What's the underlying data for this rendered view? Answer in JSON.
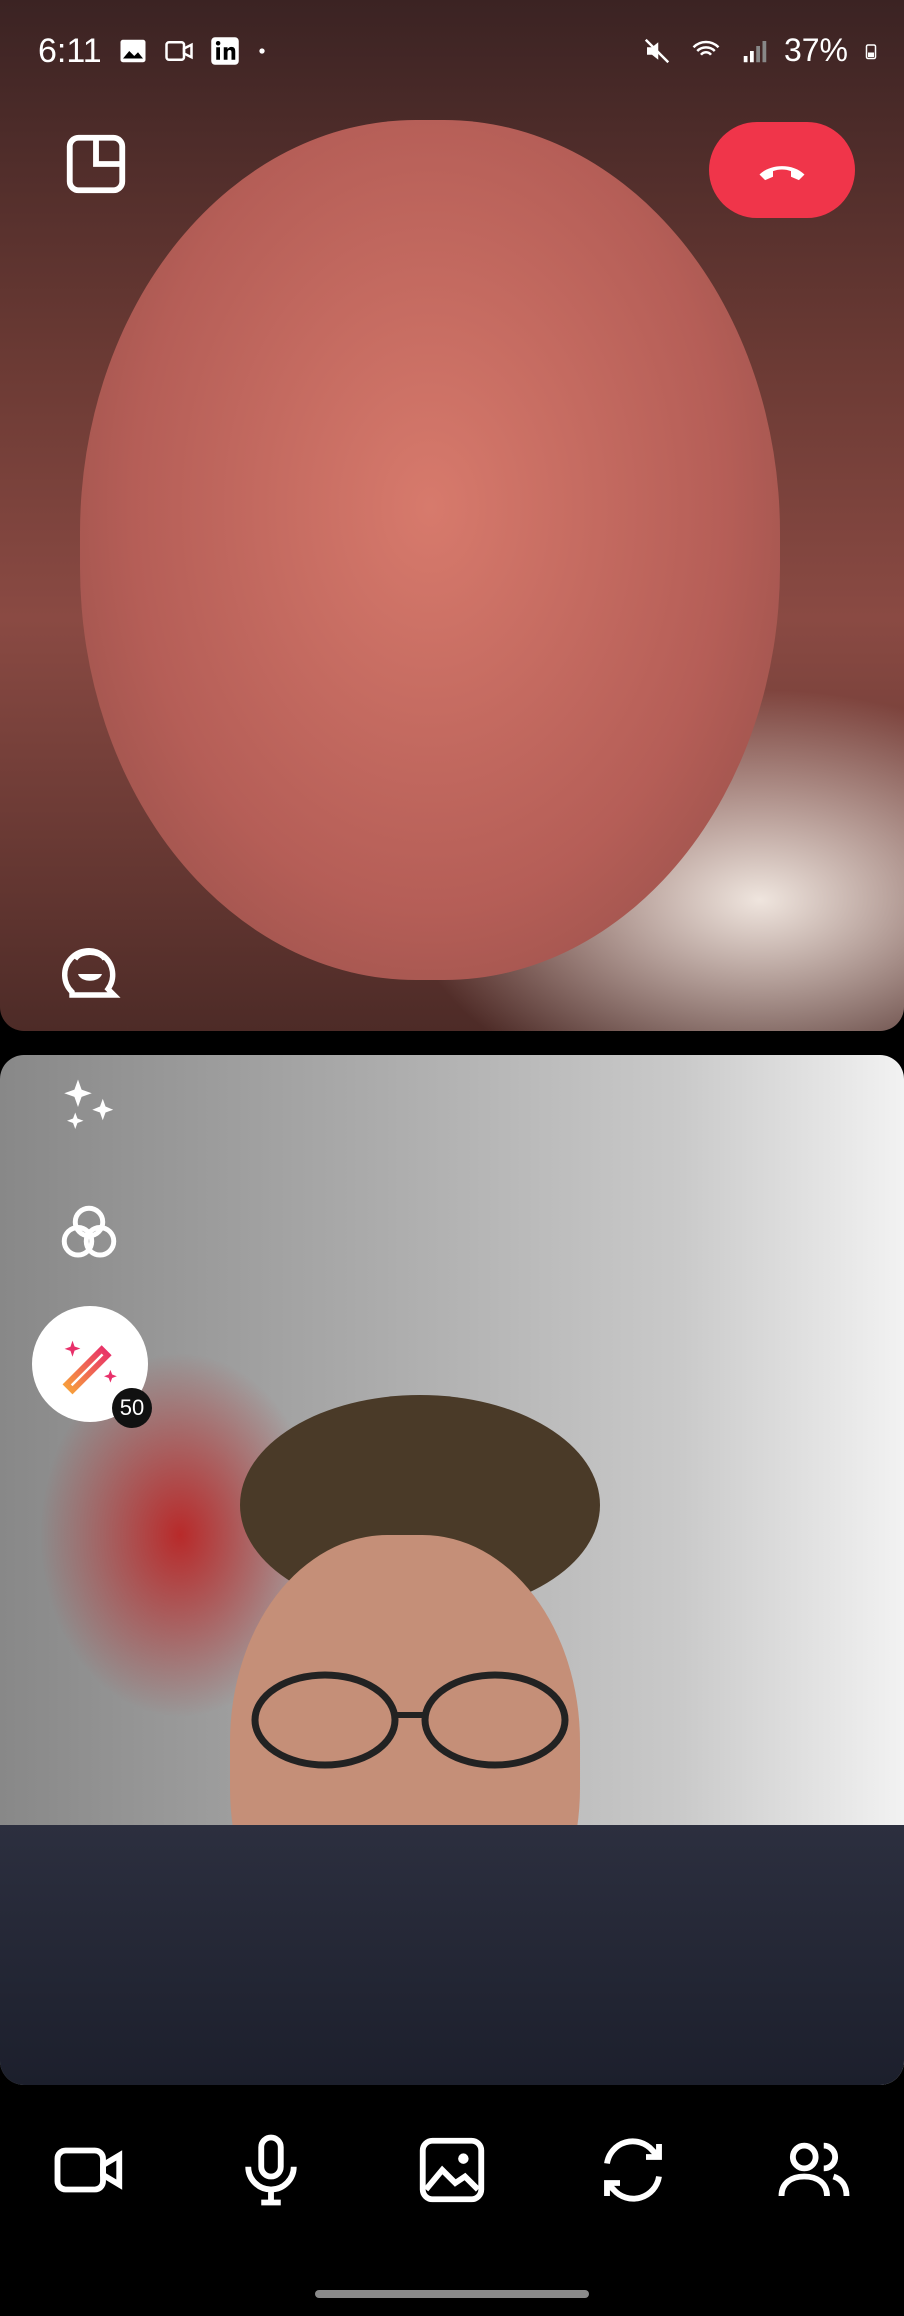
{
  "status_bar": {
    "time": "6:11",
    "battery": "37%",
    "left_icons": [
      "image-icon",
      "video-icon",
      "linkedin-icon",
      "dot-icon"
    ],
    "right_icons": [
      "mute-icon",
      "wifi-call-icon",
      "signal-icon",
      "battery-icon"
    ]
  },
  "remote_video": {
    "buttons": {
      "pip": "picture-in-picture-icon",
      "end_call": "end-call-icon",
      "avatar": "avatar-icon"
    }
  },
  "local_video": {
    "effects_badge": "50",
    "buttons": {
      "sparkle": "sparkle-icon",
      "filter": "filter-icon",
      "magic": "magic-wand-icon"
    }
  },
  "toolbar": {
    "items": [
      {
        "name": "camera",
        "icon": "video-camera-icon"
      },
      {
        "name": "microphone",
        "icon": "microphone-icon"
      },
      {
        "name": "gallery",
        "icon": "image-icon"
      },
      {
        "name": "flip-camera",
        "icon": "flip-camera-icon"
      },
      {
        "name": "participants",
        "icon": "people-icon"
      }
    ]
  },
  "colors": {
    "end_call": "#f0354a",
    "background": "#000000"
  }
}
